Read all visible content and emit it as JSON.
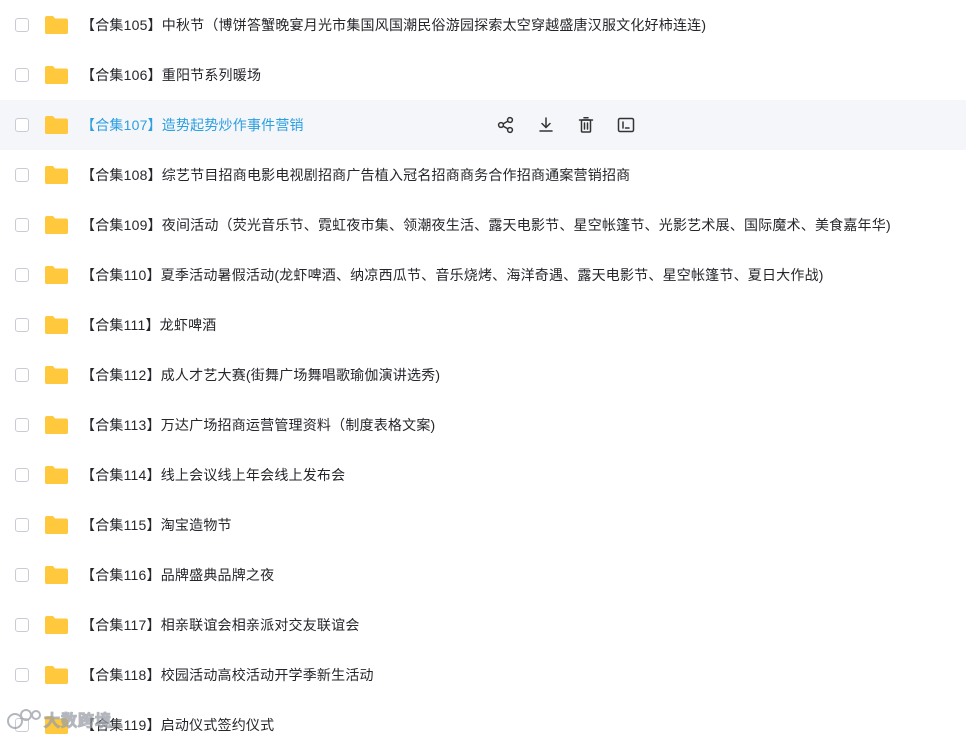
{
  "rows": [
    {
      "label": "【合集105】中秋节（博饼答蟹晚宴月光市集国风国潮民俗游园探索太空穿越盛唐汉服文化好柿连连)",
      "hover": false
    },
    {
      "label": "【合集106】重阳节系列暖场",
      "hover": false
    },
    {
      "label": "【合集107】造势起势炒作事件营销",
      "hover": true
    },
    {
      "label": "【合集108】综艺节目招商电影电视剧招商广告植入冠名招商商务合作招商通案营销招商",
      "hover": false
    },
    {
      "label": "【合集109】夜间活动（荧光音乐节、霓虹夜市集、领潮夜生活、露天电影节、星空帐篷节、光影艺术展、国际魔术、美食嘉年华)",
      "hover": false
    },
    {
      "label": "【合集110】夏季活动暑假活动(龙虾啤酒、纳凉西瓜节、音乐烧烤、海洋奇遇、露天电影节、星空帐篷节、夏日大作战)",
      "hover": false
    },
    {
      "label": "【合集111】龙虾啤酒",
      "hover": false
    },
    {
      "label": "【合集112】成人才艺大赛(街舞广场舞唱歌瑜伽演讲选秀)",
      "hover": false
    },
    {
      "label": "【合集113】万达广场招商运营管理资料（制度表格文案)",
      "hover": false
    },
    {
      "label": "【合集114】线上会议线上年会线上发布会",
      "hover": false
    },
    {
      "label": "【合集115】淘宝造物节",
      "hover": false
    },
    {
      "label": "【合集116】品牌盛典品牌之夜",
      "hover": false
    },
    {
      "label": "【合集117】相亲联谊会相亲派对交友联谊会",
      "hover": false
    },
    {
      "label": "【合集118】校园活动高校活动开学季新生活动",
      "hover": false
    },
    {
      "label": "【合集119】启动仪式签约仪式",
      "hover": false
    }
  ],
  "row_actions": [
    {
      "icon": "share-icon"
    },
    {
      "icon": "download-icon"
    },
    {
      "icon": "delete-icon"
    },
    {
      "icon": "rename-icon"
    }
  ],
  "watermark": {
    "text": "大数跨境"
  },
  "colors": {
    "folder": "#ffc83d",
    "text": "#25262b",
    "hover_text": "#2b9fe0",
    "hover_bg": "#f5f6fa",
    "checkbox_border": "#c8ccd4"
  }
}
